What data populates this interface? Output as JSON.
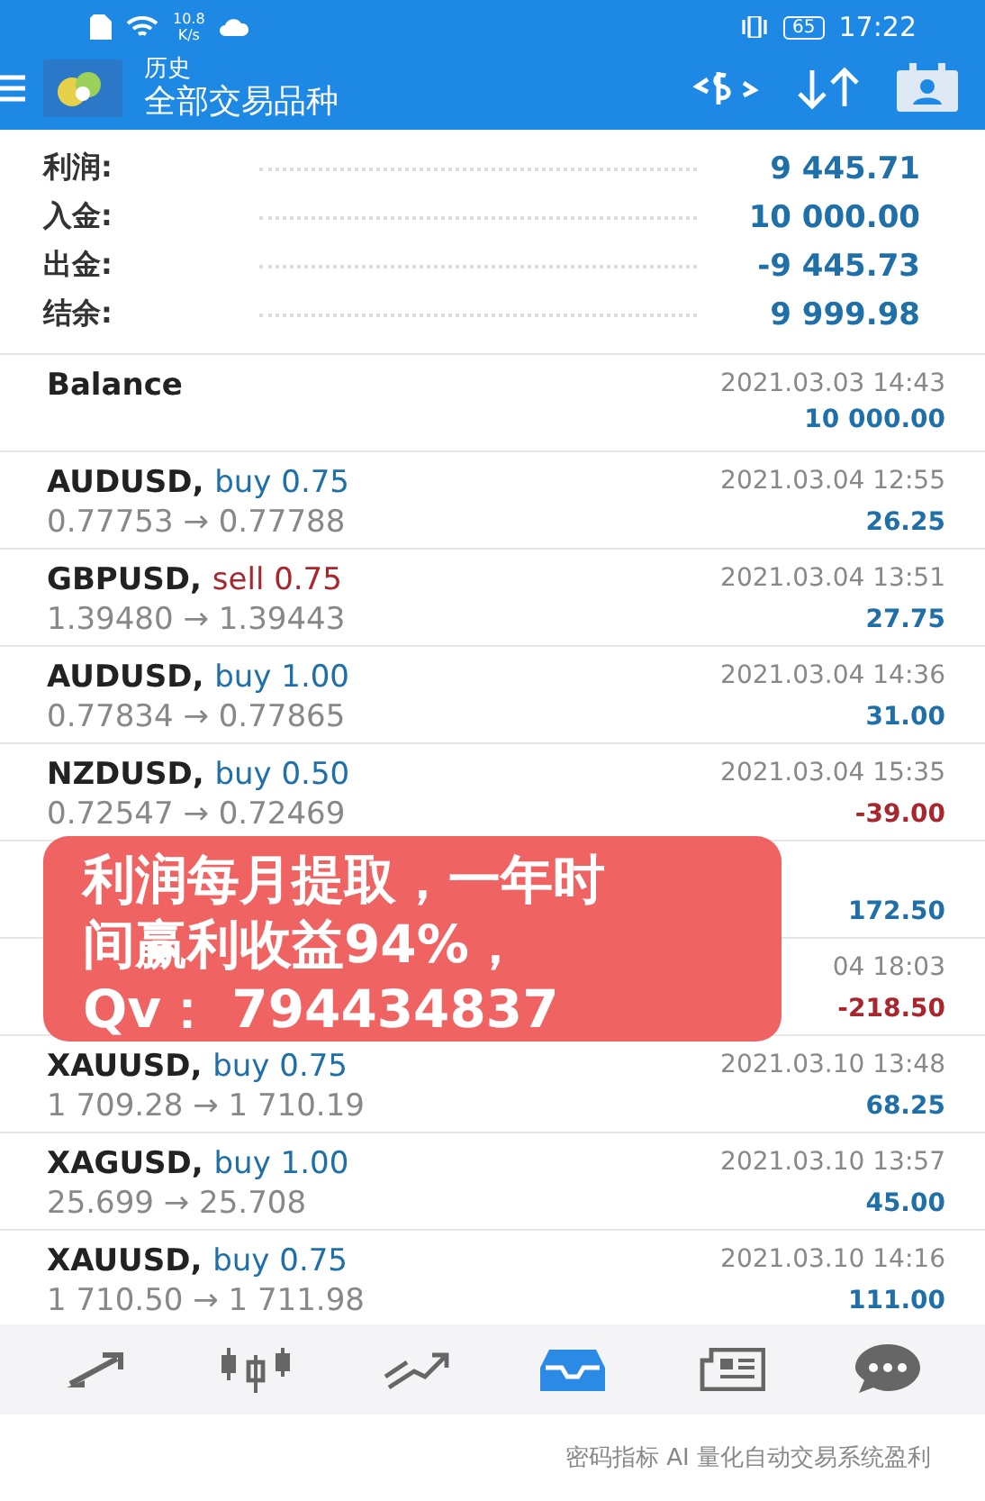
{
  "status_bar": {
    "speed": "10.8",
    "speed_unit": "K/s",
    "battery": "65",
    "time": "17:22"
  },
  "header": {
    "subtitle": "历史",
    "title": "全部交易品种"
  },
  "summary": [
    {
      "label": "利润:",
      "value": "9 445.71"
    },
    {
      "label": "入金:",
      "value": "10 000.00"
    },
    {
      "label": "出金:",
      "value": "-9 445.73"
    },
    {
      "label": "结余:",
      "value": "9 999.98"
    }
  ],
  "deals": [
    {
      "kind": "balance",
      "title": "Balance",
      "time": "2021.03.03 14:43",
      "profit": "10 000.00",
      "loss": false
    },
    {
      "kind": "buy",
      "symbol": "AUDUSD,",
      "order": "buy 0.75",
      "prices": "0.77753 → 0.77788",
      "time": "2021.03.04 12:55",
      "profit": "26.25",
      "loss": false
    },
    {
      "kind": "sell",
      "symbol": "GBPUSD,",
      "order": "sell 0.75",
      "prices": "1.39480 → 1.39443",
      "time": "2021.03.04 13:51",
      "profit": "27.75",
      "loss": false
    },
    {
      "kind": "buy",
      "symbol": "AUDUSD,",
      "order": "buy 1.00",
      "prices": "0.77834 → 0.77865",
      "time": "2021.03.04 14:36",
      "profit": "31.00",
      "loss": false
    },
    {
      "kind": "buy",
      "symbol": "NZDUSD,",
      "order": "buy 0.50",
      "prices": "0.72547 → 0.72469",
      "time": "2021.03.04 15:35",
      "profit": "-39.00",
      "loss": true
    },
    {
      "kind": "hidden",
      "profit": "172.50",
      "loss": false
    },
    {
      "kind": "hidden",
      "time": "04 18:03",
      "profit": "-218.50",
      "loss": true
    },
    {
      "kind": "buy",
      "symbol": "XAUUSD,",
      "order": "buy 0.75",
      "prices": "1 709.28 → 1 710.19",
      "time": "2021.03.10 13:48",
      "profit": "68.25",
      "loss": false
    },
    {
      "kind": "buy",
      "symbol": "XAGUSD,",
      "order": "buy 1.00",
      "prices": "25.699 → 25.708",
      "time": "2021.03.10 13:57",
      "profit": "45.00",
      "loss": false
    },
    {
      "kind": "buy",
      "symbol": "XAUUSD,",
      "order": "buy 0.75",
      "prices": "1 710.50 → 1 711.98",
      "time": "2021.03.10 14:16",
      "profit": "111.00",
      "loss": false
    }
  ],
  "promo": {
    "lines": [
      "利润每月提取，一年时",
      "间赢利收益94%，",
      "Qv：  794434837"
    ]
  },
  "nav": [
    {
      "selected": false
    },
    {
      "selected": false
    },
    {
      "selected": false
    },
    {
      "selected": true
    },
    {
      "selected": false
    },
    {
      "selected": false
    }
  ],
  "caption": "密码指标 AI 量化自动交易系统盈利"
}
